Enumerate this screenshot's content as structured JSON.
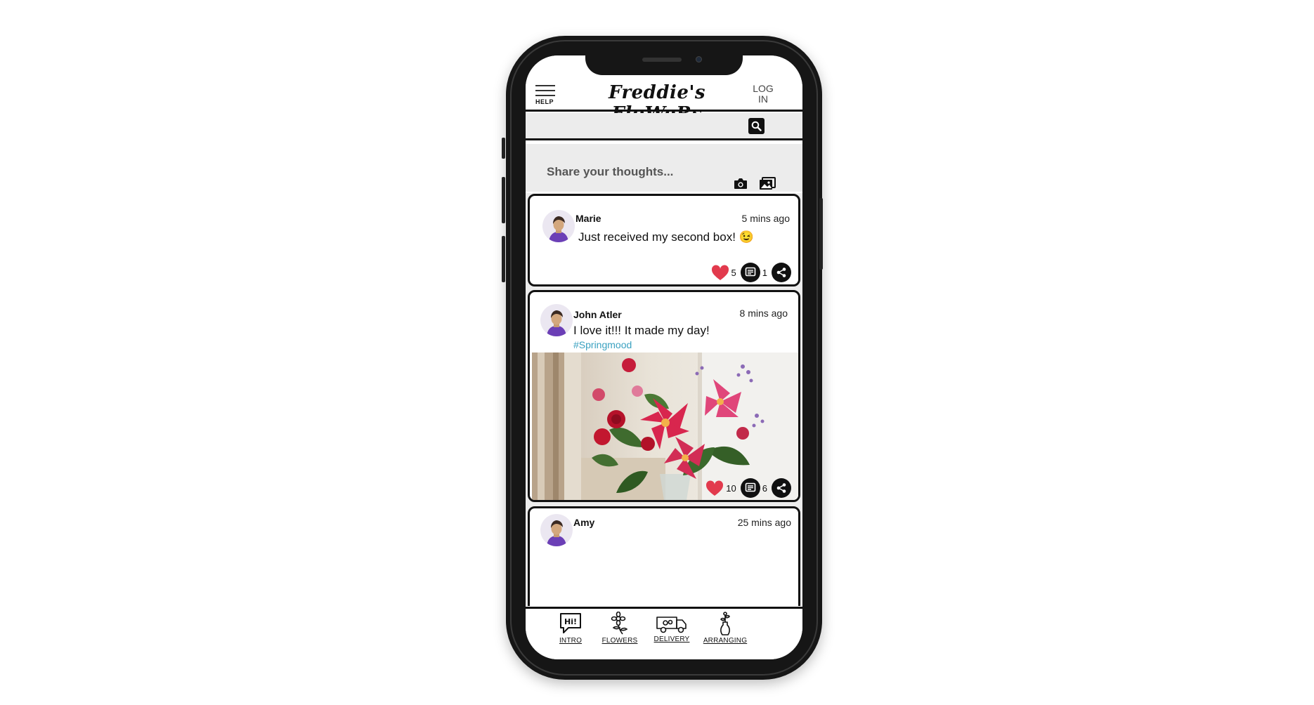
{
  "app": {
    "brand": "Freddie's FloWeRs",
    "menu_label": "HELP",
    "login_label": "LOG IN"
  },
  "composer": {
    "placeholder": "Share your thoughts..."
  },
  "icons": {
    "menu": "hamburger-menu-icon",
    "search": "search-icon",
    "camera": "camera-icon",
    "gallery": "image-gallery-icon",
    "like": "heart-icon",
    "comment": "comment-icon",
    "share": "share-icon"
  },
  "colors": {
    "heart": "#e23a4d",
    "hashtag": "#3aa1c0",
    "panel": "#ececec",
    "ink": "#111111"
  },
  "posts": [
    {
      "user": "Marie",
      "time": "5 mins ago",
      "text": "Just received my second box! 😉",
      "likes": "5",
      "comments": "1"
    },
    {
      "user": "John Atler",
      "time": "8 mins ago",
      "text": "I love it!!! It made my day!",
      "hashtag": "#Springmood",
      "likes": "10",
      "comments": "6"
    },
    {
      "user": "Amy",
      "time": "25 mins ago"
    }
  ],
  "tabs": [
    {
      "label": "INTRO",
      "icon": "speech-bubble-hi-icon"
    },
    {
      "label": "FLOWERS",
      "icon": "flower-icon"
    },
    {
      "label": "DELIVERY",
      "icon": "delivery-van-icon"
    },
    {
      "label": "ARRANGING",
      "icon": "vase-icon"
    }
  ]
}
